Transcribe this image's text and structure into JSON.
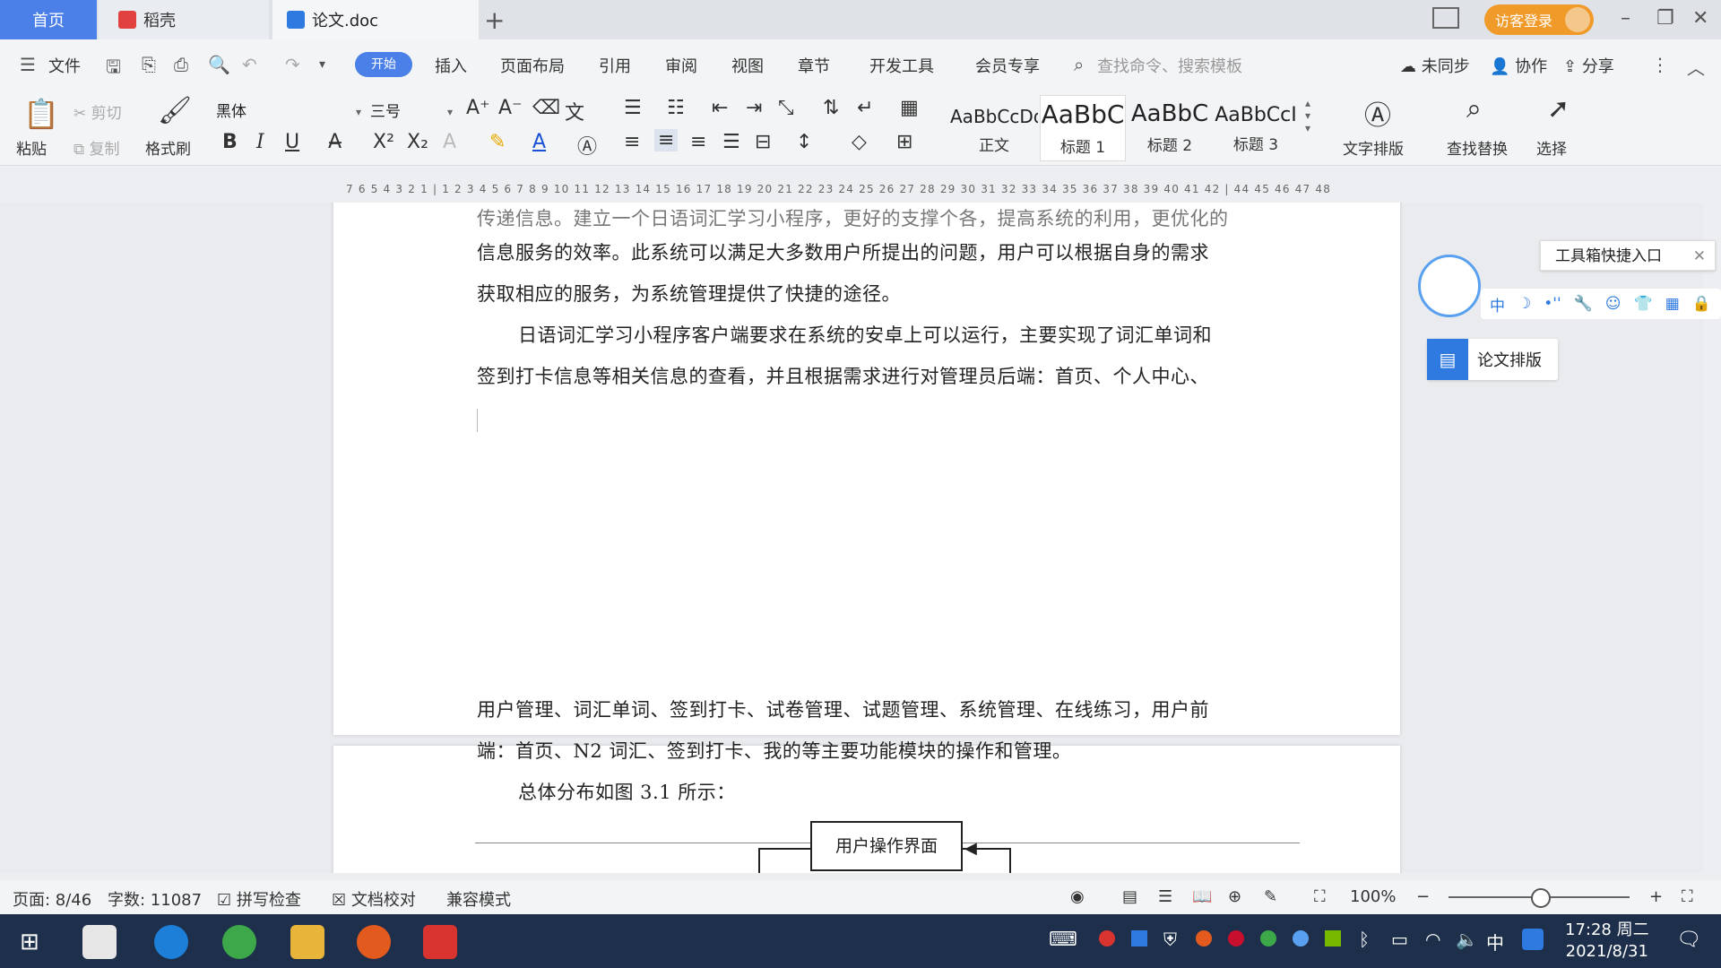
{
  "tabs": {
    "home": "首页",
    "docer": "稻壳",
    "doc": "论文.doc",
    "add": "+"
  },
  "header": {
    "login": "访客登录"
  },
  "menubar": {
    "file": "文件",
    "items": [
      "开始",
      "插入",
      "页面布局",
      "引用",
      "审阅",
      "视图",
      "章节",
      "开发工具",
      "会员专享"
    ],
    "search_placeholder": "查找命令、搜索模板",
    "sync": "未同步",
    "collab": "协作",
    "share": "分享"
  },
  "ribbon": {
    "paste": "粘贴",
    "cut": "剪切",
    "copy": "复制",
    "format_painter": "格式刷",
    "font_name": "黑体",
    "font_size": "三号",
    "styles": [
      {
        "sample": "AaBbCcDd",
        "name": "正文"
      },
      {
        "sample": "AaBbC",
        "name": "标题 1"
      },
      {
        "sample": "AaBbC",
        "name": "标题 2"
      },
      {
        "sample": "AaBbCcI",
        "name": "标题 3"
      }
    ],
    "text_layout": "文字排版",
    "find_replace": "查找替换",
    "select": "选择"
  },
  "ruler": {
    "ticks": "7 6 5 4 3 2 1 | 1 2 3 4 5 6 7 8 9 10 11 12 13 14 15 16 17 18 19 20 21 22 23 24 25 26 27 28 29 30 31 32 33 34 35 36 37 38 39 40 41 42 | 44 45 46 47 48"
  },
  "document": {
    "page1": [
      "传递信息。建立一个日语词汇学习小程序，更好的支撑个各，提高系统的利用，更优化的",
      "信息服务的效率。此系统可以满足大多数用户所提出的问题，用户可以根据自身的需求",
      "获取相应的服务，为系统管理提供了快捷的途径。",
      "日语词汇学习小程序客户端要求在系统的安卓上可以运行，主要实现了词汇单词和",
      "签到打卡信息等相关信息的查看，并且根据需求进行对管理员后端：首页、个人中心、"
    ],
    "page2": [
      "用户管理、词汇单词、签到打卡、试卷管理、试题管理、系统管理、在线练习，用户前",
      "端：首页、N2 词汇、签到打卡、我的等主要功能模块的操作和管理。",
      "总体分布如图 3.1 所示："
    ],
    "flow_box": "用户操作界面"
  },
  "side": {
    "toolbox_tip": "工具箱快捷入口",
    "assistant_items": [
      "中",
      "☽",
      "•''",
      "🔧",
      "☺",
      "👕",
      "▦",
      "🔒"
    ],
    "thesis_layout": "论文排版"
  },
  "status": {
    "page": "页面: 8/46",
    "words": "字数: 11087",
    "spell": "拼写检查",
    "proof": "文档校对",
    "compat": "兼容模式",
    "zoom": "100%"
  },
  "clock": {
    "time": "17:28 周二",
    "date": "2021/8/31"
  },
  "colors": {
    "accent": "#4a80e8",
    "login": "#f09a2a",
    "taskbar": "#1d2f4a"
  }
}
